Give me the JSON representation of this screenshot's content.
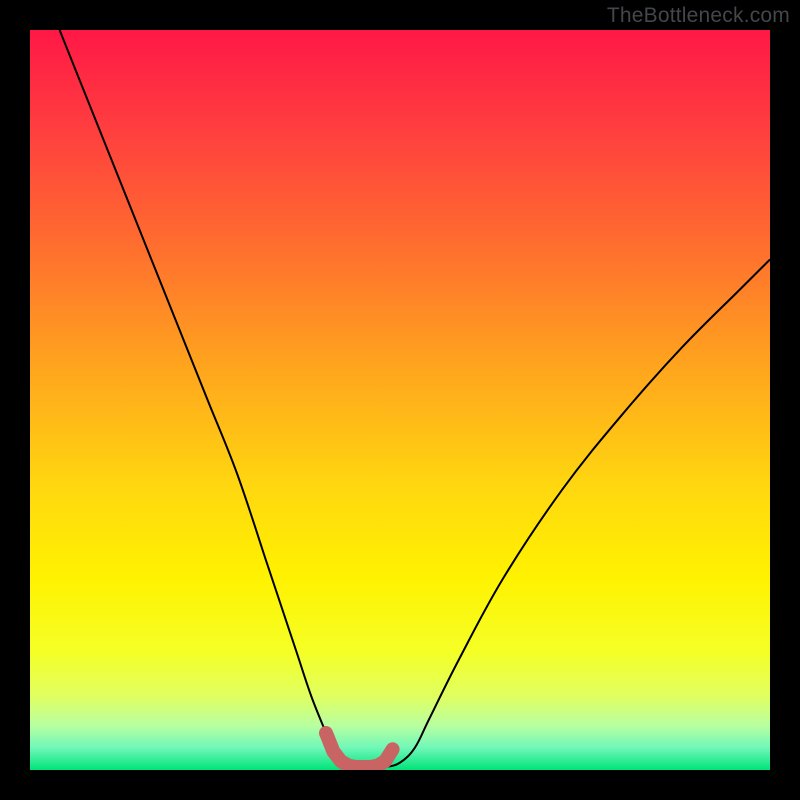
{
  "watermark": "TheBottleneck.com",
  "chart_data": {
    "type": "line",
    "title": "",
    "xlabel": "",
    "ylabel": "",
    "xlim": [
      0,
      100
    ],
    "ylim": [
      0,
      100
    ],
    "grid": false,
    "legend": false,
    "series": [
      {
        "name": "curve",
        "color": "#000000",
        "x": [
          4,
          8,
          12,
          16,
          20,
          24,
          28,
          32,
          34,
          36,
          38,
          40,
          41,
          42,
          44,
          46,
          48,
          50,
          52,
          54,
          58,
          64,
          72,
          80,
          88,
          96,
          100
        ],
        "y": [
          100,
          90,
          80,
          70,
          60,
          50,
          40,
          28,
          22,
          16,
          10,
          5,
          2.5,
          1,
          0.4,
          0.4,
          0.4,
          1,
          3,
          7,
          15,
          26,
          38,
          48,
          57,
          65,
          69
        ]
      },
      {
        "name": "bottom-marker",
        "type": "scatter",
        "color": "#c86464",
        "x": [
          40,
          41,
          42,
          43,
          44,
          45,
          46,
          47,
          48,
          49
        ],
        "y": [
          5,
          2.5,
          1.2,
          0.6,
          0.4,
          0.4,
          0.4,
          0.6,
          1.2,
          2.8
        ]
      }
    ],
    "background_gradient": {
      "type": "vertical",
      "stops": [
        {
          "pos": 0.0,
          "color": "#ff1846"
        },
        {
          "pos": 0.12,
          "color": "#ff3a40"
        },
        {
          "pos": 0.28,
          "color": "#ff6a30"
        },
        {
          "pos": 0.45,
          "color": "#ffa31e"
        },
        {
          "pos": 0.62,
          "color": "#ffd80f"
        },
        {
          "pos": 0.74,
          "color": "#fff200"
        },
        {
          "pos": 0.84,
          "color": "#f5ff26"
        },
        {
          "pos": 0.9,
          "color": "#e0ff60"
        },
        {
          "pos": 0.94,
          "color": "#b8ffa0"
        },
        {
          "pos": 0.97,
          "color": "#70f7b8"
        },
        {
          "pos": 1.0,
          "color": "#00e47a"
        }
      ]
    }
  }
}
